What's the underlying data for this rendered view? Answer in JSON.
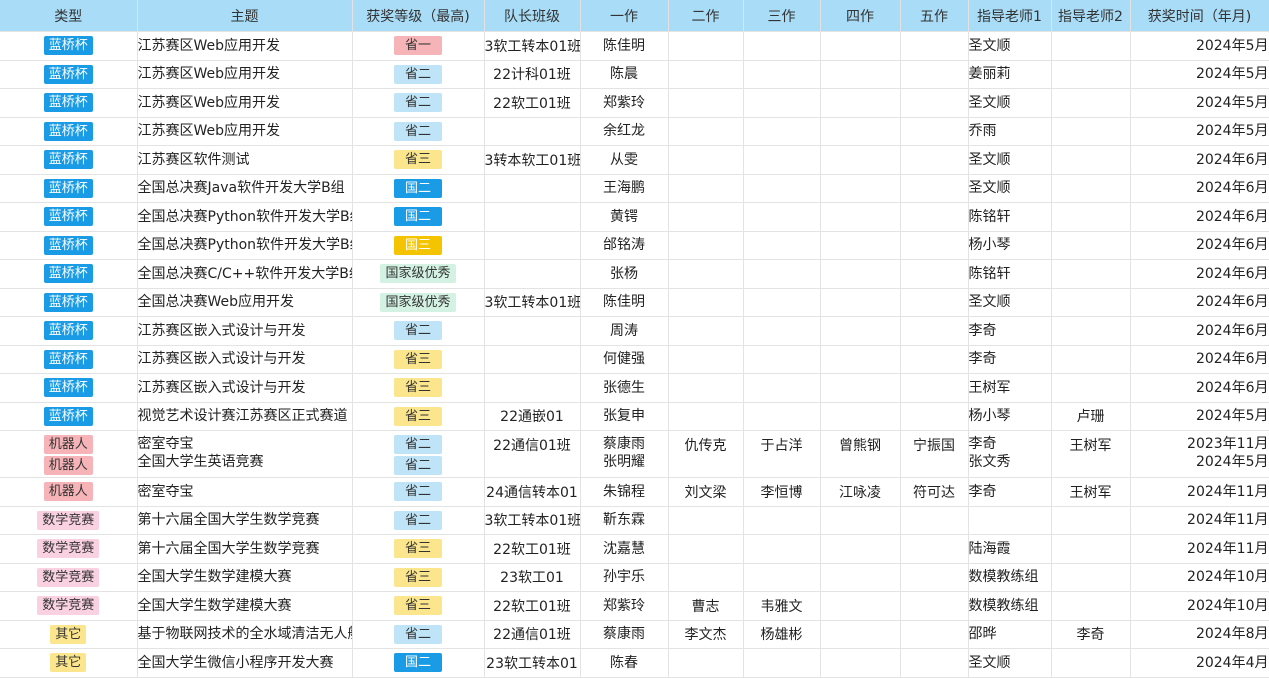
{
  "columns": [
    "类型",
    "主题",
    "获奖等级（最高)",
    "队长班级",
    "一作",
    "二作",
    "三作",
    "四作",
    "五作",
    "指导老师1",
    "指导老师2",
    "获奖时间（年月)"
  ],
  "styles": {
    "type": {
      "蓝桥杯": {
        "bg": "#1a9be6",
        "fg": "#ffffff"
      },
      "机器人": {
        "bg": "#f7b4b8",
        "fg": "#333333"
      },
      "数学竞赛": {
        "bg": "#fad1e0",
        "fg": "#333333"
      },
      "其它": {
        "bg": "#fbe58d",
        "fg": "#333333"
      }
    },
    "level": {
      "省一": {
        "bg": "#f7b4b8",
        "fg": "#333333"
      },
      "省二": {
        "bg": "#bfe4f7",
        "fg": "#333333"
      },
      "省三": {
        "bg": "#fbe58d",
        "fg": "#333333"
      },
      "国二": {
        "bg": "#1a9be6",
        "fg": "#ffffff"
      },
      "国三": {
        "bg": "#f5c400",
        "fg": "#ffffff"
      },
      "国家级优秀": {
        "bg": "#d3f2e3",
        "fg": "#333333"
      }
    }
  },
  "rows": [
    {
      "type": [
        "蓝桥杯"
      ],
      "subject": [
        "江苏赛区Web应用开发"
      ],
      "level": [
        "省一"
      ],
      "cls": "3软工转本01班",
      "a1": [
        "陈佳明"
      ],
      "a2": "",
      "a3": "",
      "a4": "",
      "a5": "",
      "t1": [
        "圣文顺"
      ],
      "t2": "",
      "date": [
        "2024年5月"
      ]
    },
    {
      "type": [
        "蓝桥杯"
      ],
      "subject": [
        "江苏赛区Web应用开发"
      ],
      "level": [
        "省二"
      ],
      "cls": "22计科01班",
      "a1": [
        "陈晨"
      ],
      "a2": "",
      "a3": "",
      "a4": "",
      "a5": "",
      "t1": [
        "姜丽莉"
      ],
      "t2": "",
      "date": [
        "2024年5月"
      ]
    },
    {
      "type": [
        "蓝桥杯"
      ],
      "subject": [
        "江苏赛区Web应用开发"
      ],
      "level": [
        "省二"
      ],
      "cls": "22软工01班",
      "a1": [
        "郑紫玲"
      ],
      "a2": "",
      "a3": "",
      "a4": "",
      "a5": "",
      "t1": [
        "圣文顺"
      ],
      "t2": "",
      "date": [
        "2024年5月"
      ]
    },
    {
      "type": [
        "蓝桥杯"
      ],
      "subject": [
        "江苏赛区Web应用开发"
      ],
      "level": [
        "省二"
      ],
      "cls": "",
      "a1": [
        "余红龙"
      ],
      "a2": "",
      "a3": "",
      "a4": "",
      "a5": "",
      "t1": [
        "乔雨"
      ],
      "t2": "",
      "date": [
        "2024年5月"
      ]
    },
    {
      "type": [
        "蓝桥杯"
      ],
      "subject": [
        "江苏赛区软件测试"
      ],
      "level": [
        "省三"
      ],
      "cls": "3转本软工01班",
      "a1": [
        "从雯"
      ],
      "a2": "",
      "a3": "",
      "a4": "",
      "a5": "",
      "t1": [
        "圣文顺"
      ],
      "t2": "",
      "date": [
        "2024年6月"
      ]
    },
    {
      "type": [
        "蓝桥杯"
      ],
      "subject": [
        "全国总决赛Java软件开发大学B组"
      ],
      "level": [
        "国二"
      ],
      "cls": "",
      "a1": [
        "王海鹏"
      ],
      "a2": "",
      "a3": "",
      "a4": "",
      "a5": "",
      "t1": [
        "圣文顺"
      ],
      "t2": "",
      "date": [
        "2024年6月"
      ]
    },
    {
      "type": [
        "蓝桥杯"
      ],
      "subject": [
        "全国总决赛Python软件开发大学B组"
      ],
      "level": [
        "国二"
      ],
      "cls": "",
      "a1": [
        "黄锷"
      ],
      "a2": "",
      "a3": "",
      "a4": "",
      "a5": "",
      "t1": [
        "陈铭轩"
      ],
      "t2": "",
      "date": [
        "2024年6月"
      ]
    },
    {
      "type": [
        "蓝桥杯"
      ],
      "subject": [
        "全国总决赛Python软件开发大学B组"
      ],
      "level": [
        "国三"
      ],
      "cls": "",
      "a1": [
        "邰铭涛"
      ],
      "a2": "",
      "a3": "",
      "a4": "",
      "a5": "",
      "t1": [
        "杨小琴"
      ],
      "t2": "",
      "date": [
        "2024年6月"
      ]
    },
    {
      "type": [
        "蓝桥杯"
      ],
      "subject": [
        "全国总决赛C/C++软件开发大学B组"
      ],
      "level": [
        "国家级优秀"
      ],
      "cls": "",
      "a1": [
        "张杨"
      ],
      "a2": "",
      "a3": "",
      "a4": "",
      "a5": "",
      "t1": [
        "陈铭轩"
      ],
      "t2": "",
      "date": [
        "2024年6月"
      ]
    },
    {
      "type": [
        "蓝桥杯"
      ],
      "subject": [
        "全国总决赛Web应用开发"
      ],
      "level": [
        "国家级优秀"
      ],
      "cls": "3软工转本01班",
      "a1": [
        "陈佳明"
      ],
      "a2": "",
      "a3": "",
      "a4": "",
      "a5": "",
      "t1": [
        "圣文顺"
      ],
      "t2": "",
      "date": [
        "2024年6月"
      ]
    },
    {
      "type": [
        "蓝桥杯"
      ],
      "subject": [
        "江苏赛区嵌入式设计与开发"
      ],
      "level": [
        "省二"
      ],
      "cls": "",
      "a1": [
        "周涛"
      ],
      "a2": "",
      "a3": "",
      "a4": "",
      "a5": "",
      "t1": [
        "李奇"
      ],
      "t2": "",
      "date": [
        "2024年6月"
      ]
    },
    {
      "type": [
        "蓝桥杯"
      ],
      "subject": [
        "江苏赛区嵌入式设计与开发"
      ],
      "level": [
        "省三"
      ],
      "cls": "",
      "a1": [
        "何健强"
      ],
      "a2": "",
      "a3": "",
      "a4": "",
      "a5": "",
      "t1": [
        "李奇"
      ],
      "t2": "",
      "date": [
        "2024年6月"
      ]
    },
    {
      "type": [
        "蓝桥杯"
      ],
      "subject": [
        "江苏赛区嵌入式设计与开发"
      ],
      "level": [
        "省三"
      ],
      "cls": "",
      "a1": [
        "张德生"
      ],
      "a2": "",
      "a3": "",
      "a4": "",
      "a5": "",
      "t1": [
        "王树军"
      ],
      "t2": "",
      "date": [
        "2024年6月"
      ]
    },
    {
      "type": [
        "蓝桥杯"
      ],
      "subject": [
        "视觉艺术设计赛江苏赛区正式赛道"
      ],
      "level": [
        "省三"
      ],
      "cls": "22通嵌01",
      "a1": [
        "张复申"
      ],
      "a2": "",
      "a3": "",
      "a4": "",
      "a5": "",
      "t1": [
        "杨小琴"
      ],
      "t2": "卢珊",
      "date": [
        "2024年5月"
      ]
    },
    {
      "tall": true,
      "type": [
        "机器人",
        "机器人"
      ],
      "subject": [
        "密室夺宝",
        "全国大学生英语竞赛"
      ],
      "level": [
        "省二",
        "省二"
      ],
      "cls": "22通信01班",
      "a1": [
        "蔡康雨",
        "张明耀"
      ],
      "a2": "仇传克",
      "a3": "于占洋",
      "a4": "曾熊钢",
      "a5": "宁振国",
      "t1": [
        "李奇",
        "张文秀"
      ],
      "t2": "王树军",
      "date": [
        "2023年11月",
        "2024年5月"
      ]
    },
    {
      "type": [
        "机器人"
      ],
      "subject": [
        "密室夺宝"
      ],
      "level": [
        "省二"
      ],
      "cls": "24通信转本01",
      "a1": [
        "朱锦程"
      ],
      "a2": "刘文梁",
      "a3": "李恒博",
      "a4": "江咏凌",
      "a5": "符可达",
      "t1": [
        "李奇"
      ],
      "t2": "王树军",
      "date": [
        "2024年11月"
      ]
    },
    {
      "type": [
        "数学竞赛"
      ],
      "subject": [
        "第十六届全国大学生数学竞赛"
      ],
      "level": [
        "省二"
      ],
      "cls": "3软工转本01班",
      "a1": [
        "靳东霖"
      ],
      "a2": "",
      "a3": "",
      "a4": "",
      "a5": "",
      "t1": [
        ""
      ],
      "t2": "",
      "date": [
        "2024年11月"
      ]
    },
    {
      "type": [
        "数学竞赛"
      ],
      "subject": [
        "第十六届全国大学生数学竞赛"
      ],
      "level": [
        "省三"
      ],
      "cls": "22软工01班",
      "a1": [
        "沈嘉慧"
      ],
      "a2": "",
      "a3": "",
      "a4": "",
      "a5": "",
      "t1": [
        "陆海霞"
      ],
      "t2": "",
      "date": [
        "2024年11月"
      ]
    },
    {
      "type": [
        "数学竞赛"
      ],
      "subject": [
        "全国大学生数学建模大赛"
      ],
      "level": [
        "省三"
      ],
      "cls": "23软工01",
      "a1": [
        "孙宇乐"
      ],
      "a2": "",
      "a3": "",
      "a4": "",
      "a5": "",
      "t1": [
        "数模教练组"
      ],
      "t2": "",
      "date": [
        "2024年10月"
      ]
    },
    {
      "type": [
        "数学竞赛"
      ],
      "subject": [
        "全国大学生数学建模大赛"
      ],
      "level": [
        "省三"
      ],
      "cls": "22软工01班",
      "a1": [
        "郑紫玲"
      ],
      "a2": "曹志",
      "a3": "韦雅文",
      "a4": "",
      "a5": "",
      "t1": [
        "数模教练组"
      ],
      "t2": "",
      "date": [
        "2024年10月"
      ]
    },
    {
      "type": [
        "其它"
      ],
      "subject": [
        "基于物联网技术的全水域清洁无人船"
      ],
      "level": [
        "省二"
      ],
      "cls": "22通信01班",
      "a1": [
        "蔡康雨"
      ],
      "a2": "李文杰",
      "a3": "杨雄彬",
      "a4": "",
      "a5": "",
      "t1": [
        "邵晔"
      ],
      "t2": "李奇",
      "date": [
        "2024年8月"
      ]
    },
    {
      "type": [
        "其它"
      ],
      "subject": [
        "全国大学生微信小程序开发大赛"
      ],
      "level": [
        "国二"
      ],
      "cls": "23软工转本01",
      "a1": [
        "陈春"
      ],
      "a2": "",
      "a3": "",
      "a4": "",
      "a5": "",
      "t1": [
        "圣文顺"
      ],
      "t2": "",
      "date": [
        "2024年4月"
      ]
    }
  ]
}
